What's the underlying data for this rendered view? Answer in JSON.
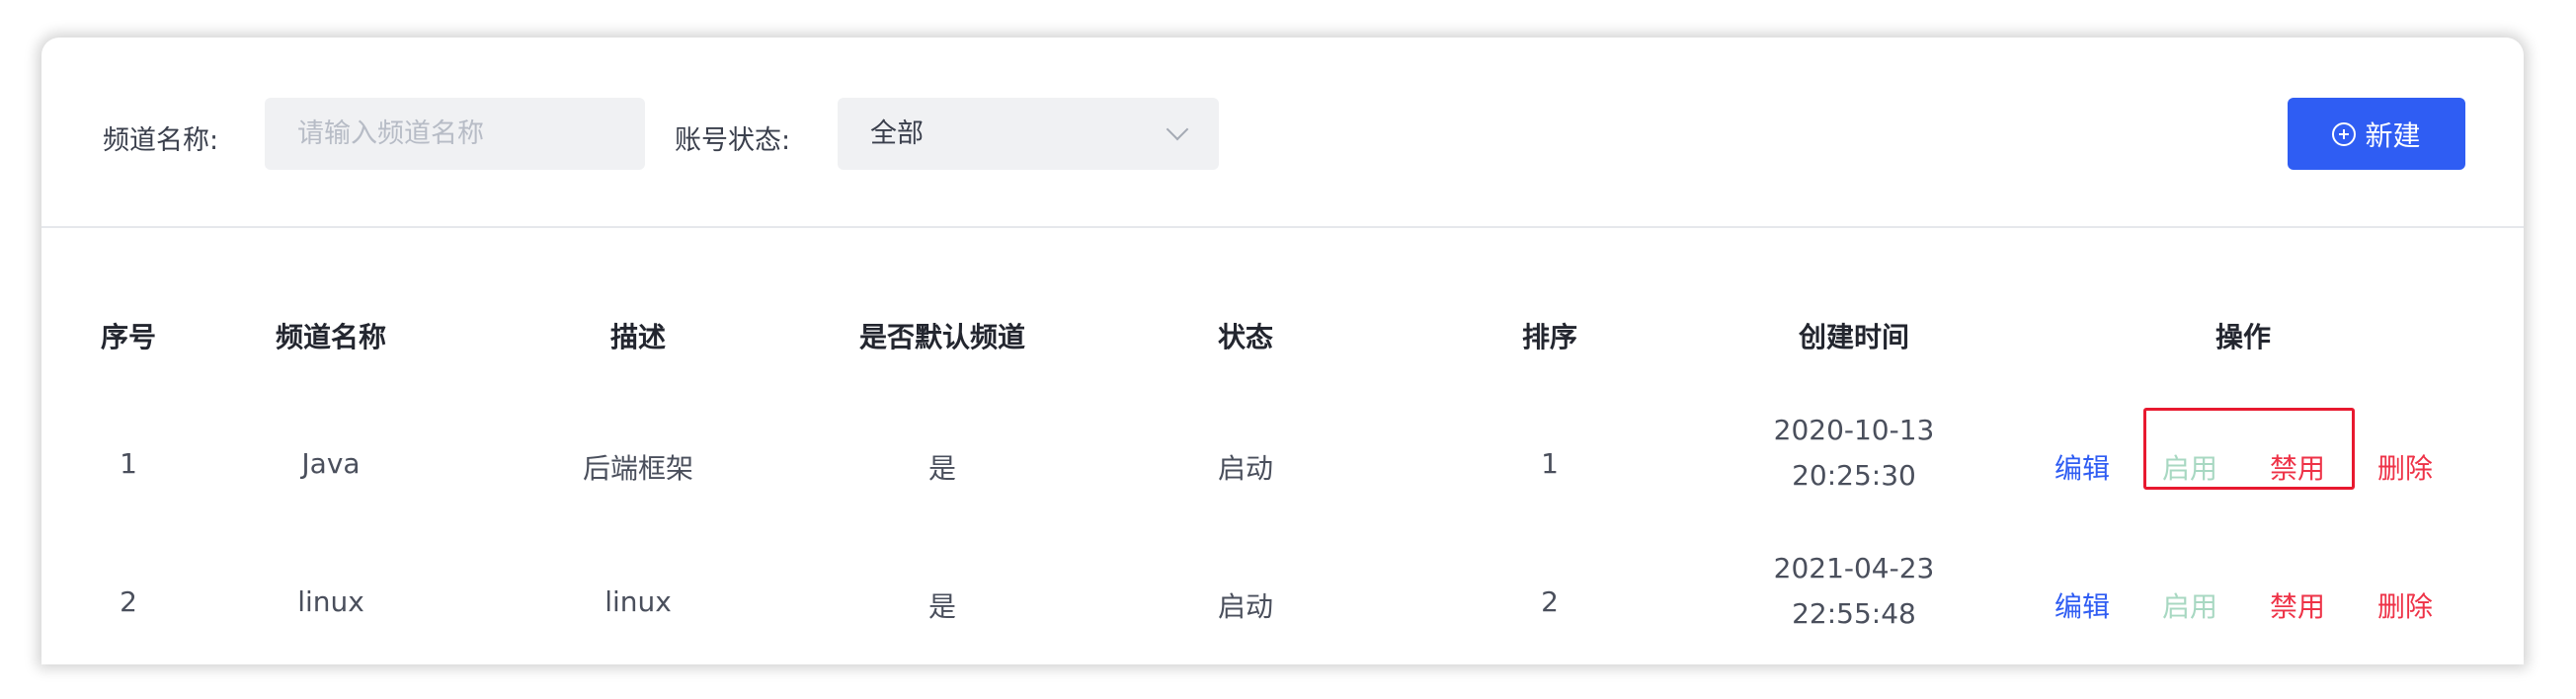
{
  "filters": {
    "channel_name_label": "频道名称:",
    "channel_name_placeholder": "请输入频道名称",
    "account_status_label": "账号状态:",
    "account_status_value": "全部",
    "new_button_label": "新建"
  },
  "table": {
    "columns": [
      "序号",
      "频道名称",
      "描述",
      "是否默认频道",
      "状态",
      "排序",
      "创建时间",
      "操作"
    ],
    "rows": [
      {
        "index": "1",
        "name": "Java",
        "description": "后端框架",
        "is_default": "是",
        "status": "启动",
        "sort": "1",
        "created_date": "2020-10-13",
        "created_time": "20:25:30"
      },
      {
        "index": "2",
        "name": "linux",
        "description": "linux",
        "is_default": "是",
        "status": "启动",
        "sort": "2",
        "created_date": "2021-04-23",
        "created_time": "22:55:48"
      }
    ],
    "actions": {
      "edit": "编辑",
      "enable": "启用",
      "disable": "禁用",
      "delete": "删除"
    }
  },
  "colors": {
    "primary": "#2f5df3",
    "danger": "#ee3247",
    "disabled_green": "#a8d8c2",
    "highlight_border": "#e8192f"
  }
}
